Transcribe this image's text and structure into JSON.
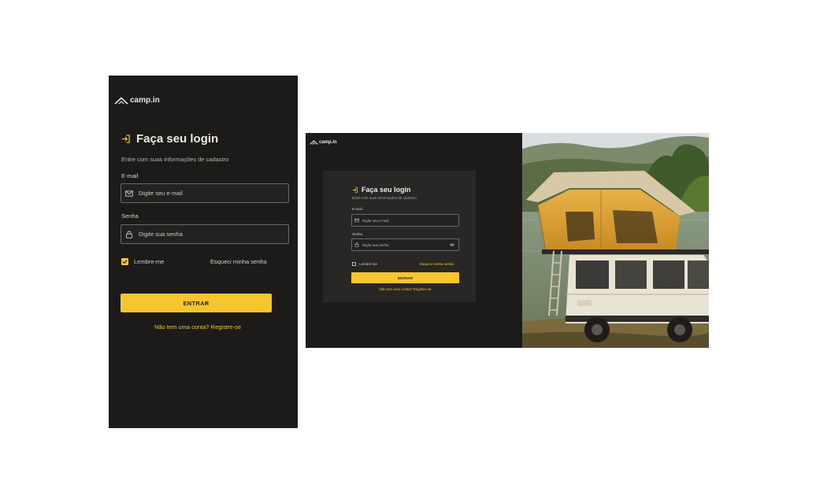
{
  "brand": {
    "name": "camp.in"
  },
  "mobile": {
    "title": "Faça seu login",
    "subtitle": "Entre com suas informações de cadastro",
    "email_label": "E-mail",
    "email_placeholder": "Digite seu e-mail",
    "password_label": "Senha",
    "password_placeholder": "Digite sua senha",
    "remember_label": "Lembre-me",
    "remember_checked": true,
    "forgot_label": "Esqueci minha senha",
    "submit_label": "ENTRAR",
    "register_label": "Não tem uma conta? Registre-se"
  },
  "desktop": {
    "title": "Faça seu login",
    "subtitle": "Entre com suas informações de cadastro",
    "email_label": "E-mail",
    "email_placeholder": "Digite seu e-mail",
    "password_label": "Senha",
    "password_placeholder": "Digite sua senha",
    "remember_label": "Lembre-me",
    "remember_checked": false,
    "forgot_label": "Esqueci minha senha",
    "submit_label": "ENTRAR",
    "register_label": "Não tem uma conta? Registre-se",
    "photo_icon": "camper-truck-rooftop-tent-photo"
  },
  "colors": {
    "background": "#1c1b1a",
    "card": "#282726",
    "accent": "#f7c52e",
    "text": "#eeeae3"
  },
  "icons": [
    "logo-tent-icon",
    "login-arrow-icon",
    "mail-icon",
    "lock-icon",
    "eye-icon",
    "check-icon"
  ]
}
